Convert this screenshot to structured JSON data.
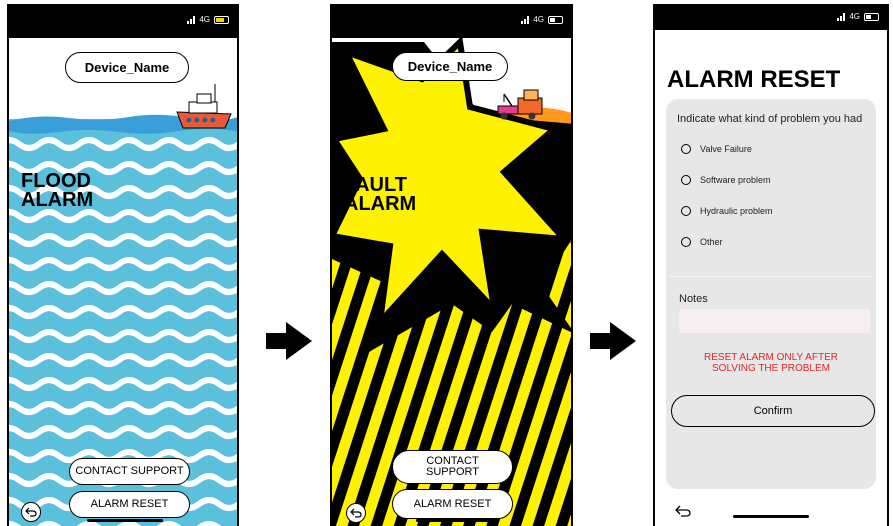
{
  "status_bar": {
    "network": "4G"
  },
  "screen1": {
    "device_name": "Device_Name",
    "alarm_title": "FLOOD\nALARM",
    "contact_support": "CONTACT SUPPORT",
    "alarm_reset": "ALARM RESET",
    "colors": {
      "water": "#5bc0dc",
      "wave": "#ffffff",
      "deep_wave": "#3a9fd8",
      "boat_hull": "#e65a3a"
    }
  },
  "screen2": {
    "device_name": "Device_Name",
    "alarm_title": "FAULT\nALARM",
    "contact_support": "CONTACT\nSUPPORT",
    "alarm_reset": "ALARM RESET",
    "colors": {
      "burst": "#fff200",
      "stripe": "#000000",
      "accent": "#ff9a1a",
      "truck": "#f06b2a"
    }
  },
  "screen3": {
    "title": "ALARM RESET",
    "question": "Indicate what kind of problem you had",
    "options": [
      "Valve Failure",
      "Software problem",
      "Hydraulic problem",
      "Other"
    ],
    "notes_label": "Notes",
    "warning": "RESET ALARM ONLY AFTER\nSOLVING THE PROBLEM",
    "confirm": "Confirm",
    "colors": {
      "warning": "#e0252a",
      "panel": "#e7e7e7",
      "notes_field": "#f7eef0"
    }
  },
  "icons": [
    "signal-icon",
    "battery-icon",
    "back-icon",
    "boat-icon",
    "tow-truck-icon",
    "arrow-right-icon"
  ]
}
